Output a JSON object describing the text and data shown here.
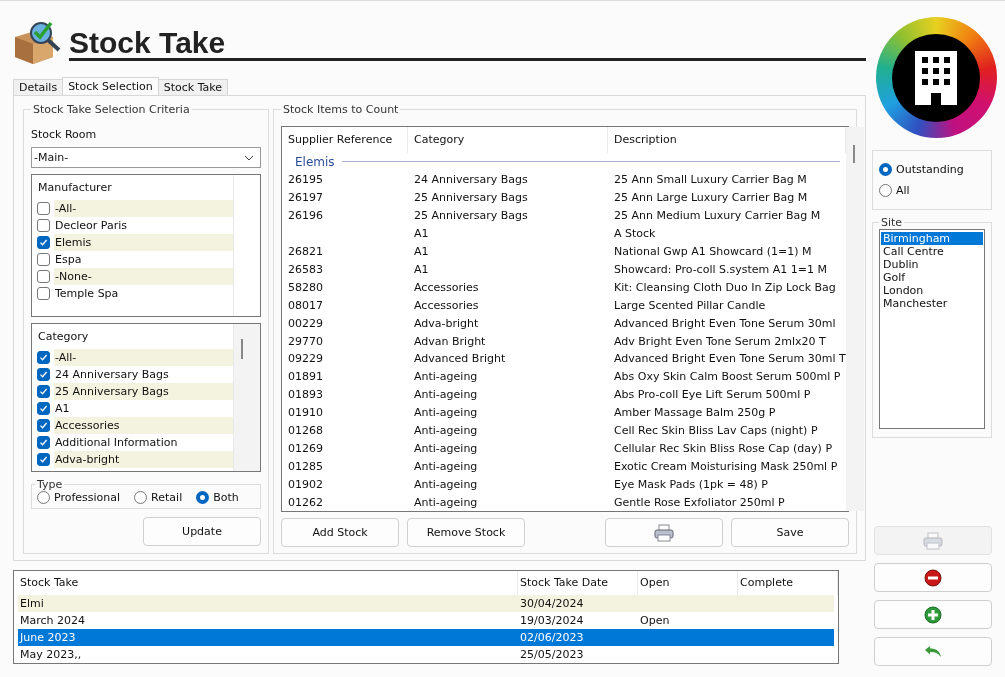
{
  "header": {
    "title": "Stock Take"
  },
  "tabs": [
    {
      "label": "Details",
      "selected": false
    },
    {
      "label": "Stock Selection",
      "selected": true
    },
    {
      "label": "Stock Take",
      "selected": false
    }
  ],
  "criteria": {
    "title": "Stock Take Selection Criteria",
    "stock_room": {
      "label": "Stock Room",
      "value": "-Main-"
    },
    "manufacturer": {
      "heading": "Manufacturer",
      "items": [
        {
          "label": "-All-",
          "checked": false
        },
        {
          "label": "Decleor Paris",
          "checked": false
        },
        {
          "label": "Elemis",
          "checked": true
        },
        {
          "label": "Espa",
          "checked": false
        },
        {
          "label": "-None-",
          "checked": false
        },
        {
          "label": "Temple Spa",
          "checked": false
        }
      ]
    },
    "category": {
      "heading": "Category",
      "items": [
        {
          "label": "-All-",
          "checked": true
        },
        {
          "label": "24 Anniversary Bags",
          "checked": true
        },
        {
          "label": "25 Anniversary Bags",
          "checked": true
        },
        {
          "label": "A1",
          "checked": true
        },
        {
          "label": "Accessories",
          "checked": true
        },
        {
          "label": "Additional Information",
          "checked": true
        },
        {
          "label": "Adva-bright",
          "checked": true
        }
      ]
    },
    "type": {
      "label": "Type",
      "options": [
        {
          "label": "Professional",
          "selected": false
        },
        {
          "label": "Retail",
          "selected": false
        },
        {
          "label": "Both",
          "selected": true
        }
      ]
    },
    "update_button": "Update"
  },
  "items": {
    "title": "Stock Items to Count",
    "columns": [
      "Supplier Reference",
      "Category",
      "Description"
    ],
    "group": "Elemis",
    "rows": [
      {
        "reference": "26195",
        "category": "24 Anniversary Bags",
        "description": "25 Ann Small Luxury Carrier Bag M"
      },
      {
        "reference": "26197",
        "category": "25 Anniversary Bags",
        "description": "25 Ann Large Luxury Carrier Bag M"
      },
      {
        "reference": "26196",
        "category": "25 Anniversary Bags",
        "description": "25 Ann Medium Luxury Carrier Bag M"
      },
      {
        "category": "A1",
        "description": "A Stock"
      },
      {
        "reference": "26821",
        "category": "A1",
        "description": "National Gwp A1 Showcard (1=1) M"
      },
      {
        "reference": "26583",
        "category": "A1",
        "description": "Showcard: Pro-coll S.system A1 1=1 M"
      },
      {
        "reference": "58280",
        "category": "Accessories",
        "description": "Kit: Cleansing Cloth Duo In Zip Lock Bag"
      },
      {
        "reference": "08017",
        "category": "Accessories",
        "description": "Large Scented Pillar Candle"
      },
      {
        "reference": "00229",
        "category": "Adva-bright",
        "description": "Advanced Bright Even Tone Serum 30ml"
      },
      {
        "reference": "29770",
        "category": "Advan Bright",
        "description": "Adv Bright Even Tone Serum 2mlx20 T"
      },
      {
        "reference": "09229",
        "category": "Advanced Bright",
        "description": "Advanced Bright Even Tone Serum 30ml T"
      },
      {
        "reference": "01891",
        "category": "Anti-ageing",
        "description": "Abs Oxy Skin Calm Boost Serum 500ml P"
      },
      {
        "reference": "01893",
        "category": "Anti-ageing",
        "description": "Abs Pro-coll Eye Lift Serum 500ml P"
      },
      {
        "reference": "01910",
        "category": "Anti-ageing",
        "description": "Amber Massage Balm 250g P"
      },
      {
        "reference": "01268",
        "category": "Anti-ageing",
        "description": "Cell Rec Skin Bliss Lav Caps (night) P"
      },
      {
        "reference": "01269",
        "category": "Anti-ageing",
        "description": "Cellular Rec Skin Bliss Rose Cap (day) P"
      },
      {
        "reference": "01285",
        "category": "Anti-ageing",
        "description": "Exotic Cream Moisturising Mask 250ml P"
      },
      {
        "reference": "01902",
        "category": "Anti-ageing",
        "description": "Eye Mask Pads (1pk = 48) P"
      },
      {
        "reference": "01262",
        "category": "Anti-ageing",
        "description": "Gentle Rose Exfoliator 250ml P"
      }
    ],
    "buttons": [
      {
        "kind": "text",
        "label": "Add Stock"
      },
      {
        "kind": "text",
        "label": "Remove Stock"
      },
      {
        "kind": "print"
      },
      {
        "kind": "text",
        "label": "Save"
      }
    ]
  },
  "filter": {
    "options": [
      {
        "label": "Outstanding",
        "selected": true
      },
      {
        "label": "All",
        "selected": false
      }
    ]
  },
  "site": {
    "label": "Site",
    "items": [
      {
        "label": "Birmingham",
        "selected": true
      },
      {
        "label": "Call Centre",
        "selected": false
      },
      {
        "label": "Dublin",
        "selected": false
      },
      {
        "label": "Golf",
        "selected": false
      },
      {
        "label": "London",
        "selected": false
      },
      {
        "label": "Manchester",
        "selected": false
      }
    ]
  },
  "actions": [
    {
      "kind": "print",
      "disabled": true
    },
    {
      "kind": "remove",
      "disabled": false
    },
    {
      "kind": "add",
      "disabled": false
    },
    {
      "kind": "undo",
      "disabled": false
    }
  ],
  "stock_takes": {
    "columns": [
      "Stock Take",
      "Stock Take Date",
      "Open",
      "Complete"
    ],
    "rows": [
      {
        "name": "Elmi",
        "date": "30/04/2024",
        "selected": false
      },
      {
        "name": "March 2024",
        "date": "19/03/2024",
        "open": "Open",
        "selected": false
      },
      {
        "name": "June 2023",
        "date": "02/06/2023",
        "selected": true
      },
      {
        "name": "May 2023,,",
        "date": "25/05/2023",
        "selected": false
      }
    ]
  }
}
